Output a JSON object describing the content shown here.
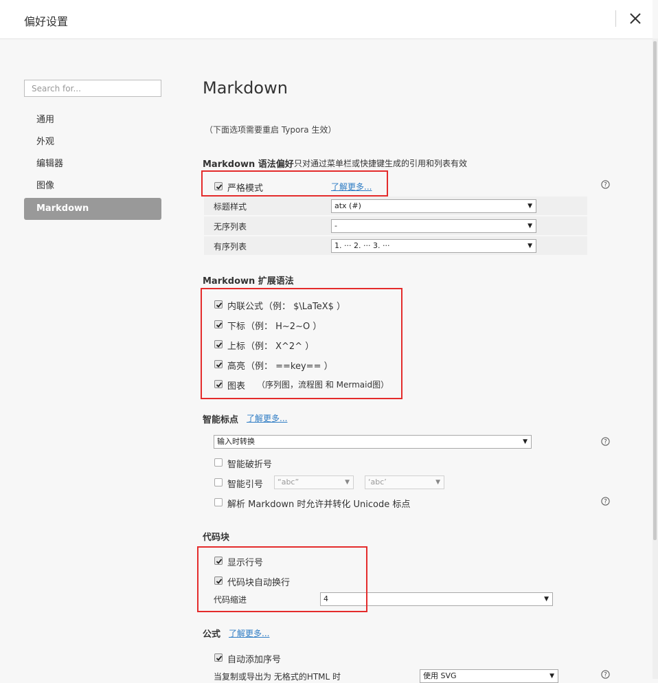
{
  "window": {
    "title": "偏好设置"
  },
  "search": {
    "placeholder": "Search for..."
  },
  "sidebar": {
    "items": [
      {
        "label": "通用"
      },
      {
        "label": "外观"
      },
      {
        "label": "编辑器"
      },
      {
        "label": "图像"
      },
      {
        "label": "Markdown",
        "active": true
      }
    ]
  },
  "main": {
    "title": "Markdown",
    "restart_note": "（下面选项需要重启 Typora 生效）",
    "syntax_pref": {
      "heading": "Markdown 语法偏好",
      "desc": "只对通过菜单栏或快捷键生成的引用和列表有效",
      "strict_mode_label": "严格模式",
      "strict_mode_checked": true,
      "learn_more": "了解更多...",
      "rows": [
        {
          "label": "标题样式",
          "value": "atx (#)"
        },
        {
          "label": "无序列表",
          "value": "-"
        },
        {
          "label": "有序列表",
          "value": "1. ··· 2. ··· 3. ···"
        }
      ]
    },
    "extended": {
      "heading": "Markdown 扩展语法",
      "items": [
        {
          "label": "内联公式",
          "example": "（例： $\\LaTeX$ ）",
          "checked": true
        },
        {
          "label": "下标",
          "example": "（例： H~2~O ）",
          "checked": true
        },
        {
          "label": "上标",
          "example": "（例： X^2^ ）",
          "checked": true
        },
        {
          "label": "高亮",
          "example": "（例： ==key== ）",
          "checked": true
        },
        {
          "label": "图表",
          "example": "（序列图，流程图 和 Mermaid图）",
          "checked": true
        }
      ]
    },
    "smart_punct": {
      "heading": "智能标点",
      "learn_more": "了解更多...",
      "mode_value": "输入时转换",
      "smart_dash": {
        "label": "智能破折号",
        "checked": false
      },
      "smart_quote": {
        "label": "智能引号",
        "checked": false,
        "double_value": "“abc”",
        "single_value": "‘abc’"
      },
      "unicode": {
        "label": "解析 Markdown 时允许并转化 Unicode 标点",
        "checked": false
      }
    },
    "codeblock": {
      "heading": "代码块",
      "show_line_numbers": {
        "label": "显示行号",
        "checked": true
      },
      "auto_wrap": {
        "label": "代码块自动换行",
        "checked": true
      },
      "indent_label": "代码缩进",
      "indent_value": "4"
    },
    "math": {
      "heading": "公式",
      "learn_more": "了解更多...",
      "auto_number": {
        "label": "自动添加序号",
        "checked": true
      },
      "copy_export_label": "当复制或导出为 无格式的HTML 时",
      "copy_export_value": "使用 SVG"
    }
  },
  "colors": {
    "annotation_box": "#e42b2b",
    "link": "#2e7cc4",
    "active_nav_bg": "#999999"
  }
}
